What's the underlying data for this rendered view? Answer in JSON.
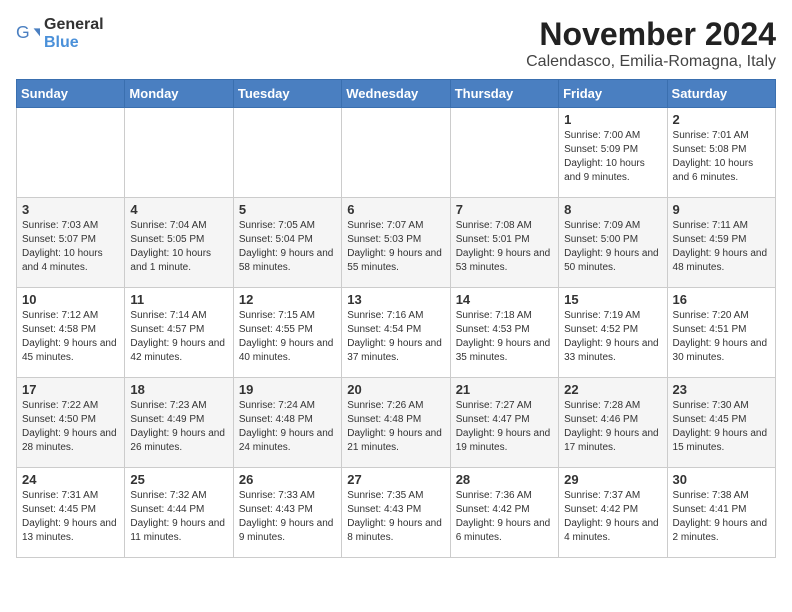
{
  "header": {
    "logo_general": "General",
    "logo_blue": "Blue",
    "title": "November 2024",
    "subtitle": "Calendasco, Emilia-Romagna, Italy"
  },
  "weekdays": [
    "Sunday",
    "Monday",
    "Tuesday",
    "Wednesday",
    "Thursday",
    "Friday",
    "Saturday"
  ],
  "weeks": [
    [
      {
        "day": "",
        "info": ""
      },
      {
        "day": "",
        "info": ""
      },
      {
        "day": "",
        "info": ""
      },
      {
        "day": "",
        "info": ""
      },
      {
        "day": "",
        "info": ""
      },
      {
        "day": "1",
        "info": "Sunrise: 7:00 AM\nSunset: 5:09 PM\nDaylight: 10 hours and 9 minutes."
      },
      {
        "day": "2",
        "info": "Sunrise: 7:01 AM\nSunset: 5:08 PM\nDaylight: 10 hours and 6 minutes."
      }
    ],
    [
      {
        "day": "3",
        "info": "Sunrise: 7:03 AM\nSunset: 5:07 PM\nDaylight: 10 hours and 4 minutes."
      },
      {
        "day": "4",
        "info": "Sunrise: 7:04 AM\nSunset: 5:05 PM\nDaylight: 10 hours and 1 minute."
      },
      {
        "day": "5",
        "info": "Sunrise: 7:05 AM\nSunset: 5:04 PM\nDaylight: 9 hours and 58 minutes."
      },
      {
        "day": "6",
        "info": "Sunrise: 7:07 AM\nSunset: 5:03 PM\nDaylight: 9 hours and 55 minutes."
      },
      {
        "day": "7",
        "info": "Sunrise: 7:08 AM\nSunset: 5:01 PM\nDaylight: 9 hours and 53 minutes."
      },
      {
        "day": "8",
        "info": "Sunrise: 7:09 AM\nSunset: 5:00 PM\nDaylight: 9 hours and 50 minutes."
      },
      {
        "day": "9",
        "info": "Sunrise: 7:11 AM\nSunset: 4:59 PM\nDaylight: 9 hours and 48 minutes."
      }
    ],
    [
      {
        "day": "10",
        "info": "Sunrise: 7:12 AM\nSunset: 4:58 PM\nDaylight: 9 hours and 45 minutes."
      },
      {
        "day": "11",
        "info": "Sunrise: 7:14 AM\nSunset: 4:57 PM\nDaylight: 9 hours and 42 minutes."
      },
      {
        "day": "12",
        "info": "Sunrise: 7:15 AM\nSunset: 4:55 PM\nDaylight: 9 hours and 40 minutes."
      },
      {
        "day": "13",
        "info": "Sunrise: 7:16 AM\nSunset: 4:54 PM\nDaylight: 9 hours and 37 minutes."
      },
      {
        "day": "14",
        "info": "Sunrise: 7:18 AM\nSunset: 4:53 PM\nDaylight: 9 hours and 35 minutes."
      },
      {
        "day": "15",
        "info": "Sunrise: 7:19 AM\nSunset: 4:52 PM\nDaylight: 9 hours and 33 minutes."
      },
      {
        "day": "16",
        "info": "Sunrise: 7:20 AM\nSunset: 4:51 PM\nDaylight: 9 hours and 30 minutes."
      }
    ],
    [
      {
        "day": "17",
        "info": "Sunrise: 7:22 AM\nSunset: 4:50 PM\nDaylight: 9 hours and 28 minutes."
      },
      {
        "day": "18",
        "info": "Sunrise: 7:23 AM\nSunset: 4:49 PM\nDaylight: 9 hours and 26 minutes."
      },
      {
        "day": "19",
        "info": "Sunrise: 7:24 AM\nSunset: 4:48 PM\nDaylight: 9 hours and 24 minutes."
      },
      {
        "day": "20",
        "info": "Sunrise: 7:26 AM\nSunset: 4:48 PM\nDaylight: 9 hours and 21 minutes."
      },
      {
        "day": "21",
        "info": "Sunrise: 7:27 AM\nSunset: 4:47 PM\nDaylight: 9 hours and 19 minutes."
      },
      {
        "day": "22",
        "info": "Sunrise: 7:28 AM\nSunset: 4:46 PM\nDaylight: 9 hours and 17 minutes."
      },
      {
        "day": "23",
        "info": "Sunrise: 7:30 AM\nSunset: 4:45 PM\nDaylight: 9 hours and 15 minutes."
      }
    ],
    [
      {
        "day": "24",
        "info": "Sunrise: 7:31 AM\nSunset: 4:45 PM\nDaylight: 9 hours and 13 minutes."
      },
      {
        "day": "25",
        "info": "Sunrise: 7:32 AM\nSunset: 4:44 PM\nDaylight: 9 hours and 11 minutes."
      },
      {
        "day": "26",
        "info": "Sunrise: 7:33 AM\nSunset: 4:43 PM\nDaylight: 9 hours and 9 minutes."
      },
      {
        "day": "27",
        "info": "Sunrise: 7:35 AM\nSunset: 4:43 PM\nDaylight: 9 hours and 8 minutes."
      },
      {
        "day": "28",
        "info": "Sunrise: 7:36 AM\nSunset: 4:42 PM\nDaylight: 9 hours and 6 minutes."
      },
      {
        "day": "29",
        "info": "Sunrise: 7:37 AM\nSunset: 4:42 PM\nDaylight: 9 hours and 4 minutes."
      },
      {
        "day": "30",
        "info": "Sunrise: 7:38 AM\nSunset: 4:41 PM\nDaylight: 9 hours and 2 minutes."
      }
    ]
  ]
}
